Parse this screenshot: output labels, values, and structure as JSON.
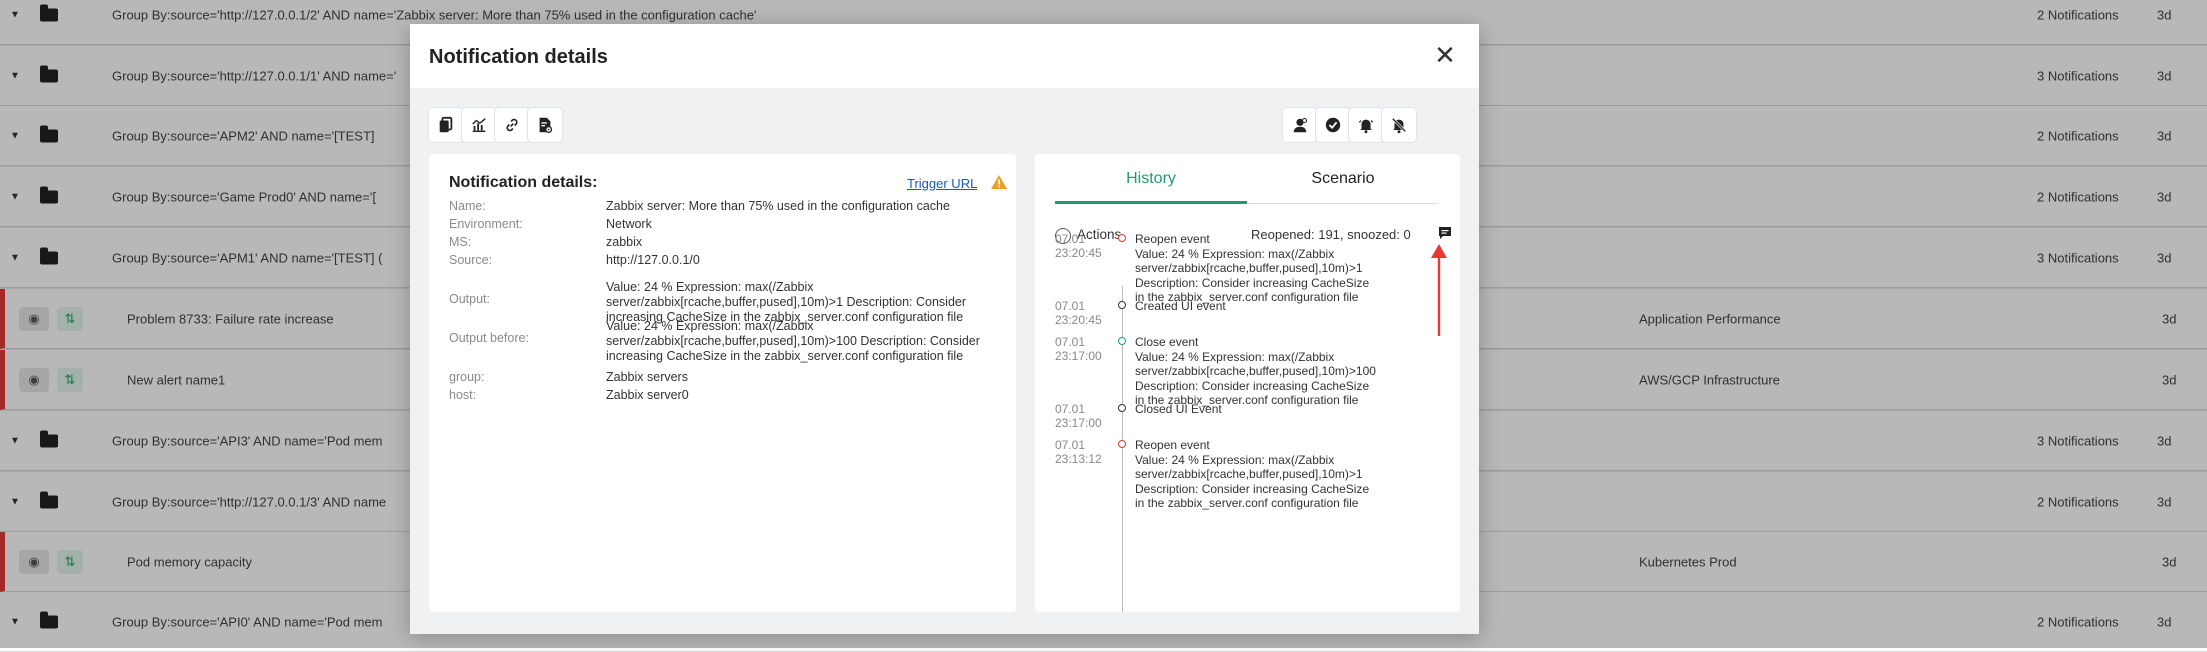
{
  "background": {
    "rows": [
      {
        "type": "group",
        "title": "Group By:source='http://127.0.0.1/2' AND name='Zabbix server: More than 75% used in the configuration cache'",
        "category": "",
        "count": "2 Notifications",
        "age": "3d"
      },
      {
        "type": "group",
        "title": "Group By:source='http://127.0.0.1/1' AND name='",
        "category": "",
        "count": "3 Notifications",
        "age": "3d"
      },
      {
        "type": "group",
        "title": "Group By:source='APM2' AND name='[TEST]",
        "category": "",
        "count": "2 Notifications",
        "age": "3d"
      },
      {
        "type": "group",
        "title": "Group By:source='Game Prod0' AND name='[",
        "category": "",
        "count": "2 Notifications",
        "age": "3d"
      },
      {
        "type": "group",
        "title": "Group By:source='APM1' AND name='[TEST] (",
        "category": "",
        "count": "3 Notifications",
        "age": "3d"
      },
      {
        "type": "alert",
        "title": "Problem 8733: Failure rate increase",
        "category": "Application Performance",
        "count": "",
        "age": "3d"
      },
      {
        "type": "alert",
        "title": "New alert name1",
        "category": "AWS/GCP Infrastructure",
        "count": "",
        "age": "3d"
      },
      {
        "type": "group",
        "title": "Group By:source='API3' AND name='Pod mem",
        "category": "",
        "count": "3 Notifications",
        "age": "3d"
      },
      {
        "type": "group",
        "title": "Group By:source='http://127.0.0.1/3' AND name",
        "category": "",
        "count": "2 Notifications",
        "age": "3d"
      },
      {
        "type": "alert",
        "title": "Pod memory capacity",
        "category": "Kubernetes Prod",
        "count": "",
        "age": "3d"
      },
      {
        "type": "group",
        "title": "Group By:source='API0' AND name='Pod mem",
        "category": "",
        "count": "2 Notifications",
        "age": "3d"
      }
    ]
  },
  "modal": {
    "title": "Notification details",
    "close_glyph": "✕"
  },
  "details": {
    "title": "Notification details:",
    "trigger_url": "Trigger URL",
    "fields": [
      {
        "label": "Name:",
        "value": "Zabbix server: More than 75% used in the configuration cache"
      },
      {
        "label": "Environment:",
        "value": "Network"
      },
      {
        "label": "MS:",
        "value": "zabbix"
      },
      {
        "label": "Source:",
        "value": "http://127.0.0.1/0"
      },
      {
        "label": "Output:",
        "value": "Value: 24 % Expression: max(/Zabbix server/zabbix[rcache,buffer,pused],10m)>1 Description: Consider increasing CacheSize in the zabbix_server.conf configuration file"
      },
      {
        "label": "Output before:",
        "value": "Value: 24 % Expression: max(/Zabbix server/zabbix[rcache,buffer,pused],10m)>100 Description: Consider increasing CacheSize in the zabbix_server.conf configuration file"
      },
      {
        "label": "group:",
        "value": "Zabbix servers"
      },
      {
        "label": "host:",
        "value": "Zabbix server0"
      }
    ]
  },
  "history": {
    "tabs": [
      "History",
      "Scenario"
    ],
    "actions_label": "Actions",
    "reopened_text": "Reopened: 191, snoozed: 0",
    "events": [
      {
        "date": "07.01",
        "time": "23:20:45",
        "color": "#e53935",
        "title": "Reopen event",
        "detail": "Value: 24 % Expression: max(/Zabbix server/zabbix[rcache,buffer,pused],10m)>1 Description: Consider increasing CacheSize in the zabbix_server.conf configuration file"
      },
      {
        "date": "07.01",
        "time": "23:20:45",
        "color": "#333333",
        "title": "Created UI event",
        "detail": ""
      },
      {
        "date": "07.01",
        "time": "23:17:00",
        "color": "#1a9e6f",
        "title": "Close event",
        "detail": "Value: 24 % Expression: max(/Zabbix server/zabbix[rcache,buffer,pused],10m)>100 Description: Consider increasing CacheSize in the zabbix_server.conf configuration file"
      },
      {
        "date": "07.01",
        "time": "23:17:00",
        "color": "#333333",
        "title": "Closed UI Event",
        "detail": ""
      },
      {
        "date": "07.01",
        "time": "23:13:12",
        "color": "#e53935",
        "title": "Reopen event",
        "detail": "Value: 24 % Expression: max(/Zabbix server/zabbix[rcache,buffer,pused],10m)>1 Description: Consider increasing CacheSize in the zabbix_server.conf configuration file"
      }
    ]
  },
  "toolbar": {
    "left": [
      "copy-icon",
      "chart-icon",
      "link-icon",
      "document-settings-icon"
    ],
    "right": [
      "assign-user-icon",
      "check-circle-icon",
      "bell-icon",
      "bell-off-icon"
    ]
  },
  "colors": {
    "accent": "#1a9e6f",
    "alert": "#e53935",
    "link": "#1a56c7",
    "warning": "#f0a020"
  }
}
